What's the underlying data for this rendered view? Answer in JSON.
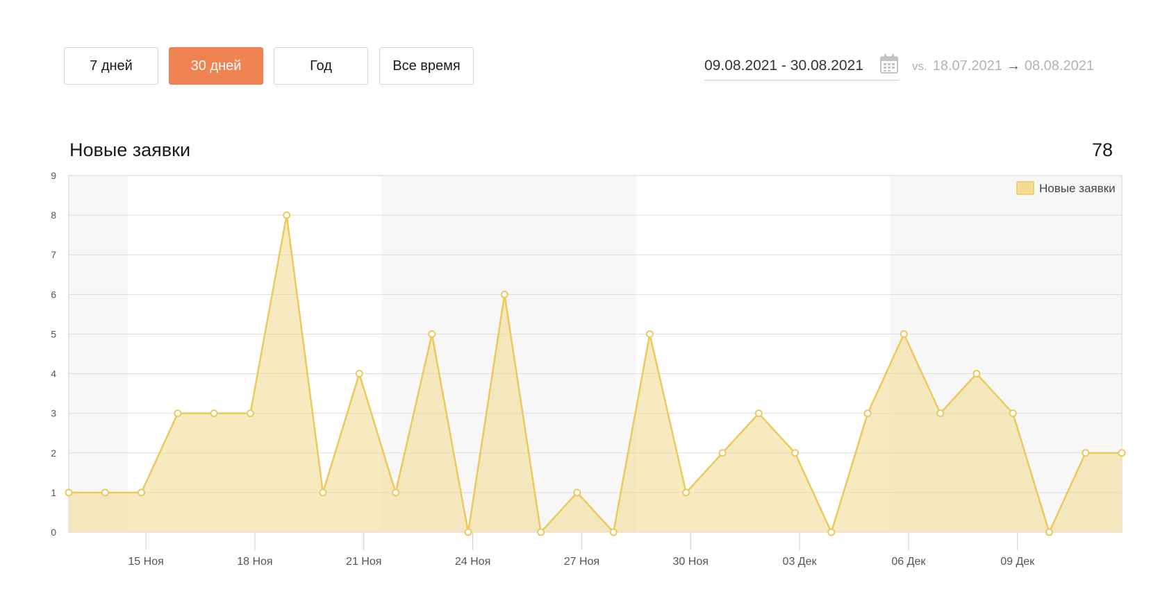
{
  "period_buttons": [
    {
      "label": "7 дней",
      "active": false
    },
    {
      "label": "30 дней",
      "active": true
    },
    {
      "label": "Год",
      "active": false
    },
    {
      "label": "Все время",
      "active": false
    }
  ],
  "date_range": "09.08.2021 - 30.08.2021",
  "compare": {
    "vs": "vs.",
    "from": "18.07.2021",
    "arrow": "→",
    "to": "08.08.2021"
  },
  "icons": {
    "calendar": "calendar-icon"
  },
  "colors": {
    "accent": "#f08352",
    "series_line": "#ecc95a",
    "series_fill": "#f2dc98",
    "band": "#f7f7f7",
    "grid": "#dddddd"
  },
  "chart_title": "Новые заявки",
  "chart_total": "78",
  "chart_data": {
    "type": "area",
    "title": "Новые заявки",
    "ylim": [
      0,
      9
    ],
    "yticks": [
      "0",
      "1",
      "2",
      "3",
      "4",
      "5",
      "6",
      "7",
      "8",
      "9"
    ],
    "x_tick_labels": [
      {
        "index": 2.125,
        "label": "15 Ноя"
      },
      {
        "index": 5.125,
        "label": "18 Ноя"
      },
      {
        "index": 8.125,
        "label": "21 Ноя"
      },
      {
        "index": 11.125,
        "label": "24 Ноя"
      },
      {
        "index": 14.125,
        "label": "27 Ноя"
      },
      {
        "index": 17.125,
        "label": "30 Ноя"
      },
      {
        "index": 20.125,
        "label": "03 Дек"
      },
      {
        "index": 23.125,
        "label": "06 Дек"
      },
      {
        "index": 26.125,
        "label": "09 Дек"
      }
    ],
    "bands": [
      [
        0,
        1.625
      ],
      [
        8.625,
        15.625
      ],
      [
        22.625,
        29
      ]
    ],
    "series": [
      {
        "name": "Новые заявки",
        "values": [
          1,
          1,
          1,
          3,
          3,
          3,
          8,
          1,
          4,
          1,
          5,
          0,
          6,
          0,
          1,
          0,
          5,
          1,
          2,
          3,
          2,
          0,
          3,
          5,
          3,
          4,
          3,
          0,
          2,
          2
        ]
      }
    ],
    "legend": "top-right",
    "grid": true
  }
}
